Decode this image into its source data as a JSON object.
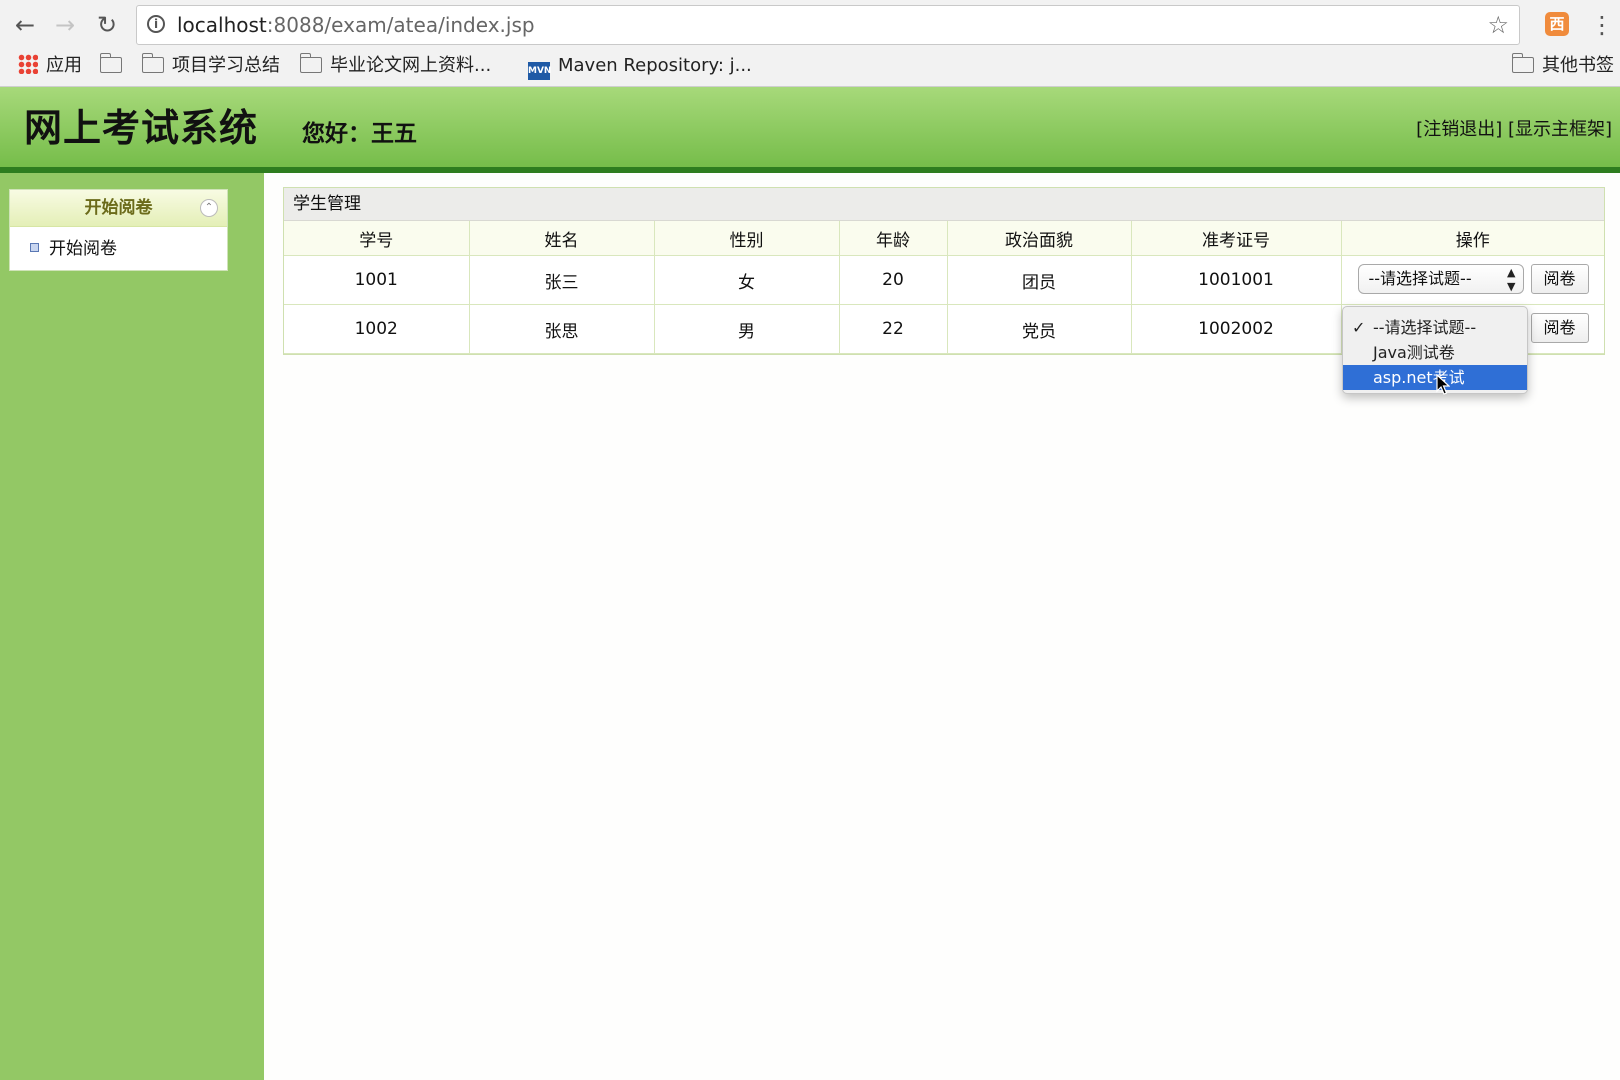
{
  "browser": {
    "url_host": "localhost",
    "url_path": ":8088/exam/atea/index.jsp",
    "bookmarks": [
      "应用",
      "",
      "项目学习总结",
      "毕业论文网上资料...",
      "Maven Repository: j...",
      "其他书签"
    ],
    "mvn_badge": "MVN",
    "ext_badge": "西"
  },
  "header": {
    "title": "网上考试系统",
    "greeting": "您好：王五",
    "link_logout": "[注销退出]",
    "link_frame": "[显示主框架]",
    "colors": {
      "green_light": "#a7d97a",
      "green_dark": "#2e7d1f",
      "sidebar_green": "#93c865"
    }
  },
  "sidebar": {
    "panel_title": "开始阅卷",
    "items": [
      "开始阅卷"
    ]
  },
  "main": {
    "panel_title": "学生管理",
    "columns": [
      "学号",
      "姓名",
      "性别",
      "年龄",
      "政治面貌",
      "准考证号",
      "操作"
    ],
    "rows": [
      [
        "1001",
        "张三",
        "女",
        "20",
        "团员",
        "1001001"
      ],
      [
        "1002",
        "张思",
        "男",
        "22",
        "党员",
        "1002002"
      ]
    ],
    "select_value": "--请选择试题--",
    "read_button": "阅卷"
  },
  "dropdown": {
    "options": [
      "--请选择试题--",
      "Java测试卷",
      "asp.net考试"
    ],
    "checked_index": 0,
    "highlighted_index": 2,
    "highlight_color": "#2f6fd6"
  }
}
